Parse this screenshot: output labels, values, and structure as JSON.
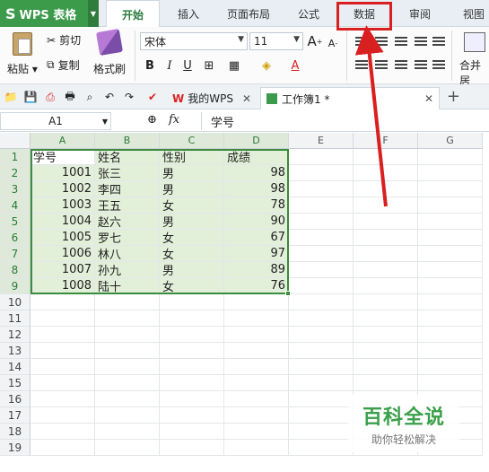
{
  "app": {
    "name": "WPS 表格",
    "logo": "S"
  },
  "menu": {
    "tabs": [
      {
        "label": "开始",
        "active": true
      },
      {
        "label": "插入"
      },
      {
        "label": "页面布局"
      },
      {
        "label": "公式"
      },
      {
        "label": "数据"
      },
      {
        "label": "审阅"
      },
      {
        "label": "视图"
      }
    ]
  },
  "ribbon": {
    "paste": "粘贴",
    "cut": "剪切",
    "copy": "复制",
    "format_painter": "格式刷",
    "font_name": "宋体",
    "font_size": "11",
    "bold": "B",
    "italic": "I",
    "underline": "U",
    "grow": "A",
    "shrink": "A",
    "merge": "合并居"
  },
  "doc_tabs": [
    {
      "label": "我的WPS",
      "icon": "W"
    },
    {
      "label": "工作簿1 *",
      "active": true
    }
  ],
  "formula_bar": {
    "cell_ref": "A1",
    "fx": "fx",
    "value": "学号"
  },
  "grid": {
    "columns": [
      "A",
      "B",
      "C",
      "D",
      "E",
      "F",
      "G"
    ],
    "rows": [
      "1",
      "2",
      "3",
      "4",
      "5",
      "6",
      "7",
      "8",
      "9",
      "10",
      "11",
      "12",
      "13",
      "14",
      "15",
      "16",
      "17",
      "18",
      "19"
    ],
    "header": [
      "学号",
      "姓名",
      "性别",
      "成绩"
    ],
    "records": [
      [
        "1001",
        "张三",
        "男",
        "98"
      ],
      [
        "1002",
        "李四",
        "男",
        "98"
      ],
      [
        "1003",
        "王五",
        "女",
        "78"
      ],
      [
        "1004",
        "赵六",
        "男",
        "90"
      ],
      [
        "1005",
        "罗七",
        "女",
        "67"
      ],
      [
        "1006",
        "林八",
        "女",
        "97"
      ],
      [
        "1007",
        "孙九",
        "男",
        "89"
      ],
      [
        "1008",
        "陆十",
        "女",
        "76"
      ]
    ]
  },
  "watermark": {
    "title": "百科全说",
    "subtitle": "助你轻松解决"
  },
  "colors": {
    "brand_green": "#3c9a4b",
    "annotation_red": "#d92020",
    "selection_fill": "#e2f0da"
  }
}
